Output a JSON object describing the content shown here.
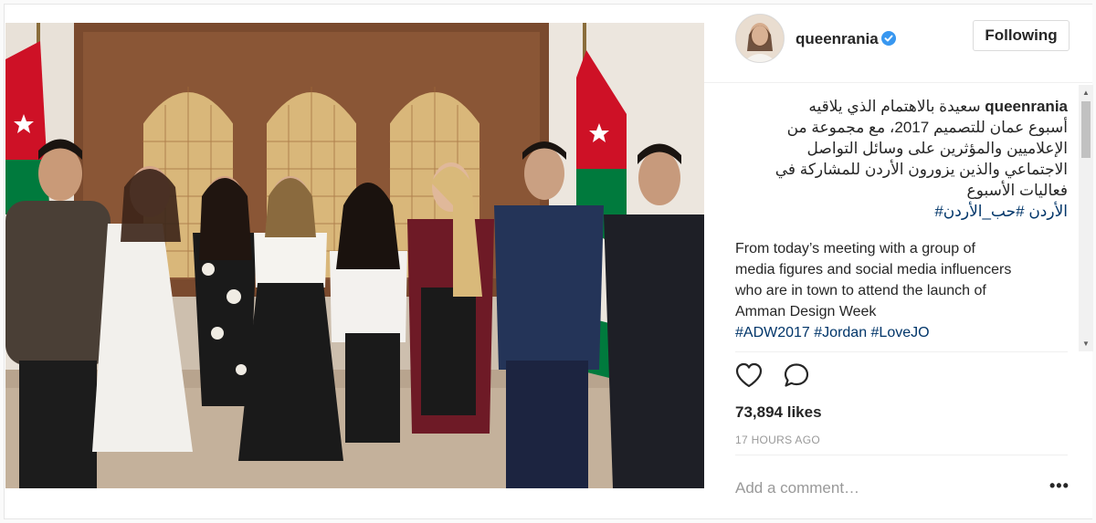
{
  "post": {
    "username": "queenrania",
    "follow_label": "Following",
    "caption_user": "queenrania",
    "caption_arabic_lines": [
      "سعيدة بالاهتمام الذي يلاقيه",
      "أسبوع عمان للتصميم 2017، مع مجموعة من",
      "الإعلاميين والمؤثرين على وسائل التواصل",
      "الاجتماعي والذين يزورون الأردن للمشاركة في",
      "فعاليات الأسبوع"
    ],
    "caption_arabic_tags": "الأردن #حب_الأردن#",
    "caption_english_lines": [
      "From today’s meeting with a group of",
      "media figures and social media influencers",
      "who are in town to attend the launch of",
      "Amman Design Week"
    ],
    "caption_english_tags": "#ADW2017 #Jordan #LoveJO",
    "likes": "73,894 likes",
    "timestamp": "17 HOURS AGO",
    "comment_placeholder": "Add a comment…",
    "more_label": "•••"
  },
  "icons": {
    "like": "heart-icon",
    "comment": "comment-icon",
    "verified": "verified-badge-icon",
    "more": "more-options-icon"
  },
  "colors": {
    "verified_blue": "#3897f0",
    "hashtag_blue": "#003569",
    "flag_red": "#ce1126",
    "flag_green": "#007a3d"
  }
}
